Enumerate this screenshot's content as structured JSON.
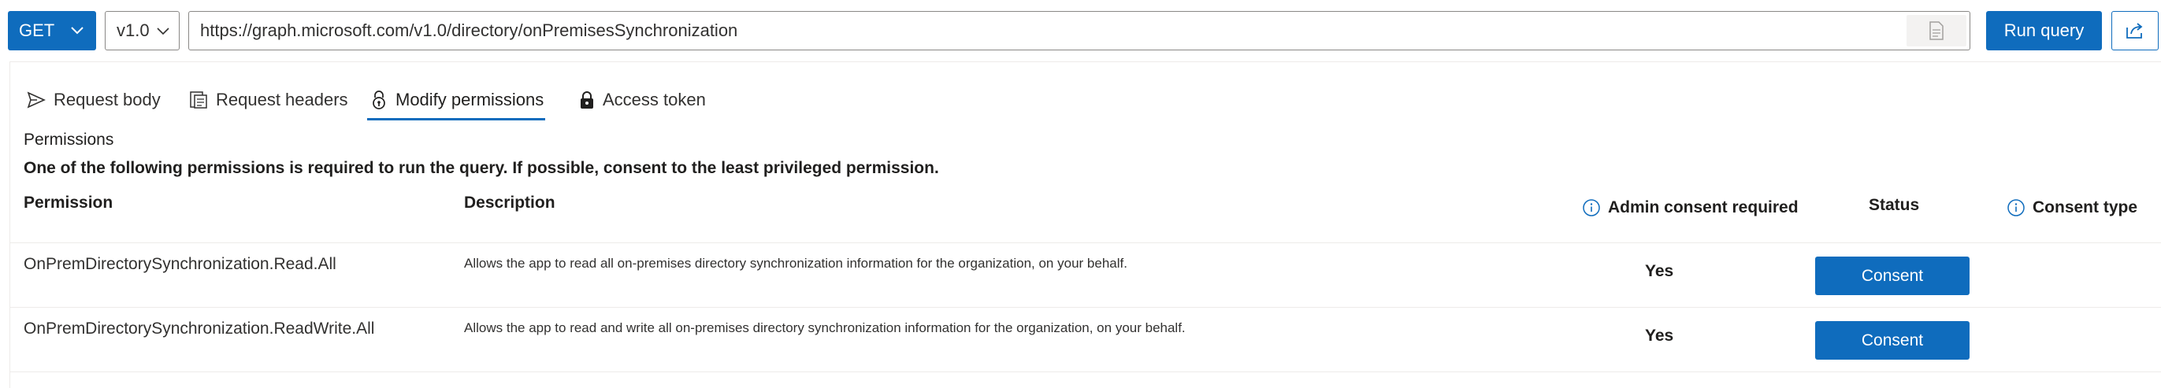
{
  "query_bar": {
    "method": "GET",
    "version": "v1.0",
    "url": "https://graph.microsoft.com/v1.0/directory/onPremisesSynchronization",
    "run_label": "Run query",
    "icons": {
      "method_chevron": "chevron-down-icon",
      "version_chevron": "chevron-down-icon",
      "doc": "document-icon",
      "share": "share-icon"
    }
  },
  "tabs": [
    {
      "label": "Request body",
      "icon": "send-icon",
      "active": false
    },
    {
      "label": "Request headers",
      "icon": "headers-icon",
      "active": false
    },
    {
      "label": "Modify permissions",
      "icon": "lock-icon",
      "active": true
    },
    {
      "label": "Access token",
      "icon": "token-lock-icon",
      "active": false
    }
  ],
  "permissions": {
    "title": "Permissions",
    "description": "One of the following permissions is required to run the query. If possible, consent to the least privileged permission.",
    "columns": {
      "permission": "Permission",
      "description": "Description",
      "admin_consent": "Admin consent required",
      "status": "Status",
      "consent_type": "Consent type"
    },
    "rows": [
      {
        "name": "OnPremDirectorySynchronization.Read.All",
        "description": "Allows the app to read all on-premises directory synchronization information for the organization, on your behalf.",
        "admin_consent": "Yes",
        "action": "Consent"
      },
      {
        "name": "OnPremDirectorySynchronization.ReadWrite.All",
        "description": "Allows the app to read and write all on-premises directory synchronization information for the organization, on your behalf.",
        "admin_consent": "Yes",
        "action": "Consent"
      }
    ]
  },
  "colors": {
    "accent": "#0f6cbd",
    "border": "#8a8886",
    "divider": "#edebe9"
  }
}
